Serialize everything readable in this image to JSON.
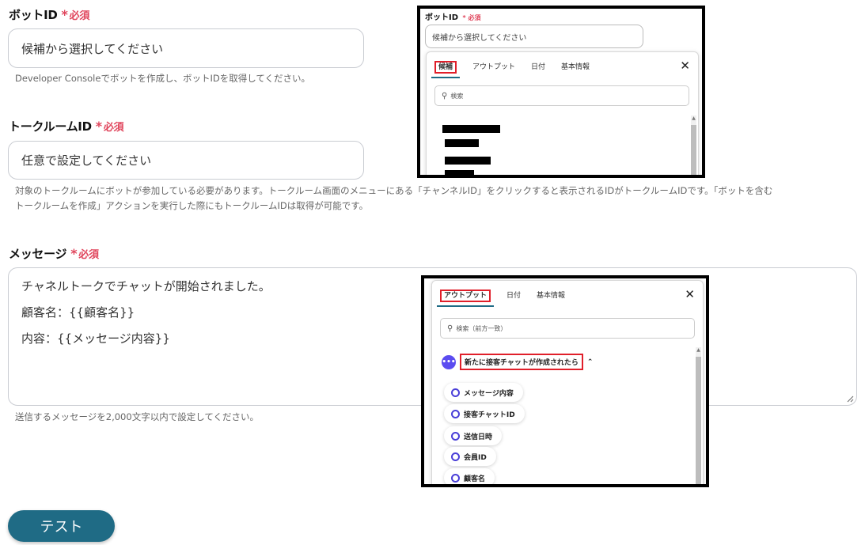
{
  "fields": {
    "bot_id": {
      "label": "ボットID",
      "required": "必須",
      "placeholder": "候補から選択してください",
      "help": "Developer Consoleでボットを作成し、ボットIDを取得してください。"
    },
    "room_id": {
      "label": "トークルームID",
      "required": "必須",
      "placeholder": "任意で設定してください",
      "help_line1": "対象のトークルームにボットが参加している必要があります。トークルーム画面のメニューにある「チャンネルID」をクリックすると表示されるIDがトークルームIDです。「ボットを含む",
      "help_line2": "トークルームを作成」アクションを実行した際にもトークルームIDは取得が可能です。"
    },
    "message": {
      "label": "メッセージ",
      "required": "必須",
      "lines": [
        "チャネルトークでチャットが開始されました。",
        "顧客名：{{顧客名}}",
        "内容：{{メッセージ内容}}"
      ],
      "help": "送信するメッセージを2,000文字以内で設定してください。"
    }
  },
  "test_button": "テスト",
  "inset1": {
    "label": "ボットID",
    "required": "必須",
    "placeholder": "候補から選択してください",
    "tabs": [
      "候補",
      "アウトプット",
      "日付",
      "基本情報"
    ],
    "search_placeholder": "検索"
  },
  "inset2": {
    "tabs": [
      "アウトプット",
      "日付",
      "基本情報"
    ],
    "search_placeholder": "検索（前方一致）",
    "group_label": "新たに接客チャットが作成されたら",
    "items": [
      "メッセージ内容",
      "接客チャットID",
      "送信日時",
      "会員ID",
      "顧客名"
    ]
  },
  "icons": {
    "close": "close-icon",
    "search": "search-icon",
    "bot": "bot-icon",
    "caret": "chevron-up-icon",
    "resize": "resize-handle-icon"
  },
  "colors": {
    "required": "#e0455c",
    "button": "#1f6b85",
    "highlight": "#e01f2a",
    "bot_icon": "#5b4cf0"
  }
}
